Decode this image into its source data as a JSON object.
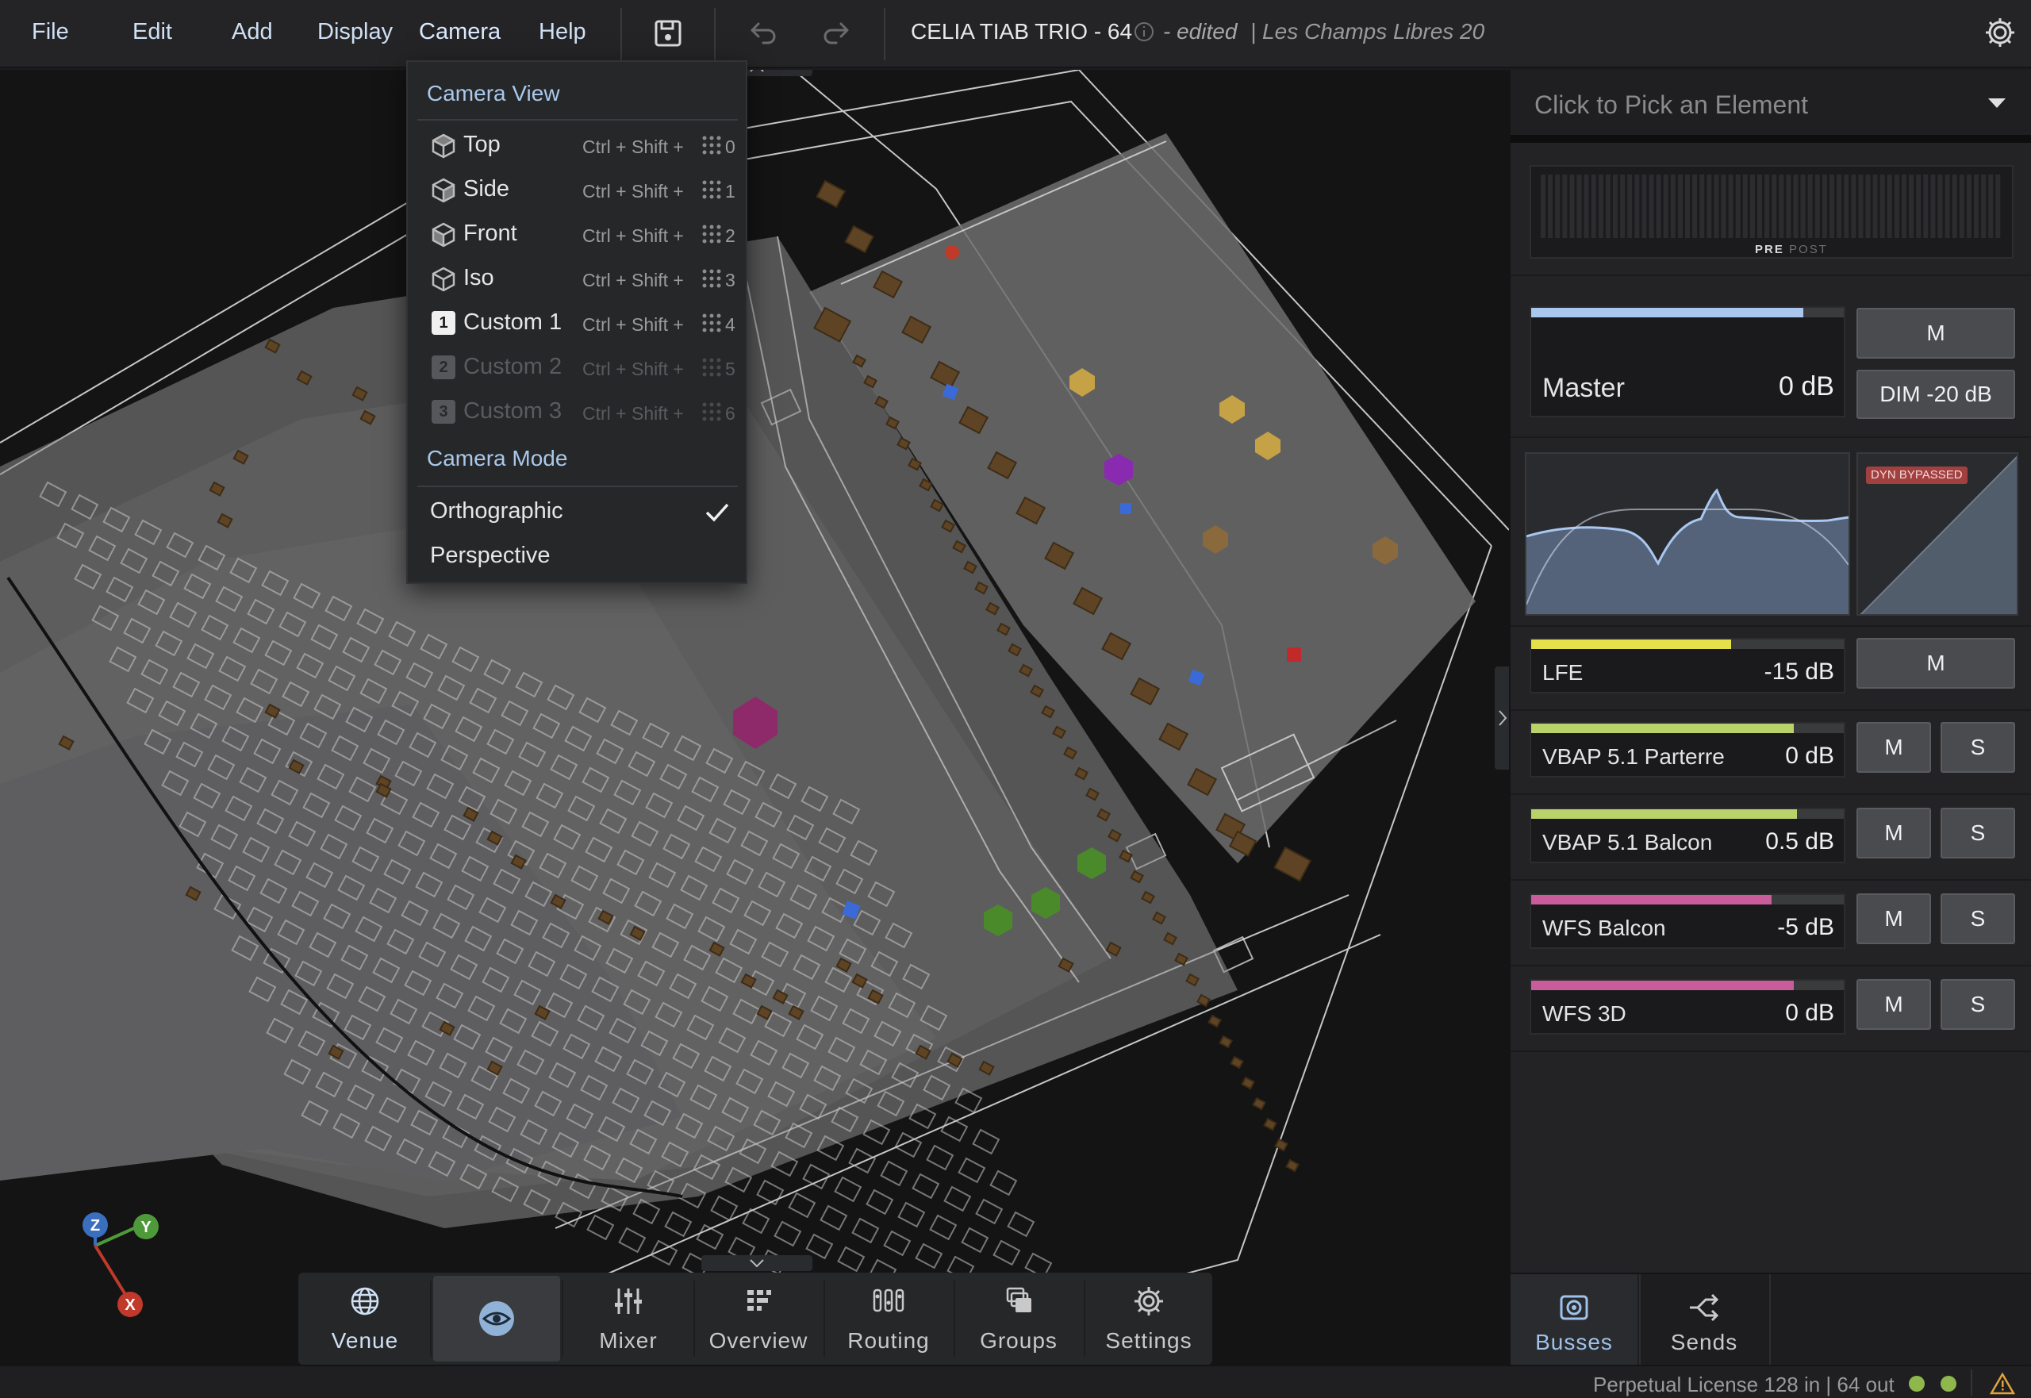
{
  "menu": {
    "file": "File",
    "edit": "Edit",
    "add": "Add",
    "display": "Display",
    "camera": "Camera",
    "help": "Help"
  },
  "title": {
    "project": "CELIA TIAB TRIO - 64",
    "edited": "- edited",
    "venue": "| Les Champs Libres 20"
  },
  "camera_menu": {
    "view_heading": "Camera View",
    "views": [
      {
        "label": "Top",
        "shortcut": "Ctrl + Shift +",
        "key": "0",
        "icon": "cube-icon"
      },
      {
        "label": "Side",
        "shortcut": "Ctrl + Shift +",
        "key": "1",
        "icon": "cube-icon"
      },
      {
        "label": "Front",
        "shortcut": "Ctrl + Shift +",
        "key": "2",
        "icon": "cube-icon"
      },
      {
        "label": "Iso",
        "shortcut": "Ctrl + Shift +",
        "key": "3",
        "icon": "cube-icon"
      },
      {
        "label": "Custom 1",
        "shortcut": "Ctrl + Shift +",
        "key": "4",
        "badge": "1"
      },
      {
        "label": "Custom 2",
        "shortcut": "Ctrl + Shift +",
        "key": "5",
        "badge": "2"
      },
      {
        "label": "Custom 3",
        "shortcut": "Ctrl + Shift +",
        "key": "6",
        "badge": "3"
      }
    ],
    "mode_heading": "Camera Mode",
    "modes": [
      "Orthographic",
      "Perspective"
    ],
    "selected_mode": "Orthographic"
  },
  "bottom_toolbar": {
    "venue": "Venue",
    "mixer": "Mixer",
    "overview": "Overview",
    "routing": "Routing",
    "groups": "Groups",
    "settings": "Settings"
  },
  "gizmo": {
    "z": "Z",
    "y": "Y",
    "x": "X"
  },
  "right_panel": {
    "picker_placeholder": "Click to Pick an Element",
    "meter_pre": "PRE",
    "meter_post": "POST",
    "master": {
      "name": "Master",
      "db": "0 dB",
      "mute": "M",
      "dim": "DIM -20 dB",
      "level": 0.87
    },
    "dyn_badge": "DYN BYPASSED",
    "busses": [
      {
        "name": "LFE",
        "db": "-15 dB",
        "mute": "M",
        "color": "#e6e04a",
        "level": 0.64
      },
      {
        "name": "VBAP 5.1 Parterre",
        "db": "0 dB",
        "mute": "M",
        "solo": "S",
        "color": "#b9d26a",
        "level": 0.84
      },
      {
        "name": "VBAP 5.1 Balcon",
        "db": "0.5 dB",
        "mute": "M",
        "solo": "S",
        "color": "#b9d26a",
        "level": 0.85
      },
      {
        "name": "WFS Balcon",
        "db": "-5 dB",
        "mute": "M",
        "solo": "S",
        "color": "#c95c9a",
        "level": 0.77
      },
      {
        "name": "WFS 3D",
        "db": "0 dB",
        "mute": "M",
        "solo": "S",
        "color": "#c95c9a",
        "level": 0.84
      }
    ],
    "tabs": {
      "busses": "Busses",
      "sends": "Sends"
    }
  },
  "status": {
    "license": "Perpetual License 128 in | 64 out"
  },
  "colors": {
    "accent": "#9fc2ea",
    "led_green": "#8fb84c",
    "warning": "#e0a43a"
  }
}
